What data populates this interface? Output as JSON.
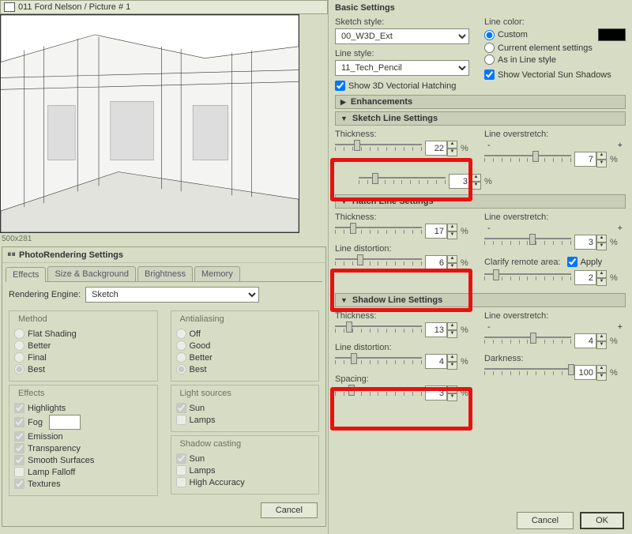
{
  "window_title": "011 Ford Nelson / Picture # 1",
  "preview_dim": "500x281",
  "dlg": {
    "title": "PhotoRendering Settings",
    "tabs": [
      "Effects",
      "Size & Background",
      "Brightness",
      "Memory"
    ],
    "active_tab": 0,
    "engine_label": "Rendering Engine:",
    "engine_value": "Sketch",
    "method": {
      "legend": "Method",
      "opts": [
        "Flat Shading",
        "Better",
        "Final",
        "Best"
      ],
      "sel": 3
    },
    "antialias": {
      "legend": "Antialiasing",
      "opts": [
        "Off",
        "Good",
        "Better",
        "Best"
      ],
      "sel": 3
    },
    "effects": {
      "legend": "Effects",
      "items": [
        {
          "label": "Highlights",
          "on": true
        },
        {
          "label": "Fog",
          "on": true,
          "has_input": true,
          "val": ""
        },
        {
          "label": "Emission",
          "on": true
        },
        {
          "label": "Transparency",
          "on": true
        },
        {
          "label": "Smooth Surfaces",
          "on": true
        },
        {
          "label": "Lamp Falloff",
          "on": false
        },
        {
          "label": "Textures",
          "on": true
        }
      ]
    },
    "light": {
      "legend": "Light sources",
      "items": [
        {
          "label": "Sun",
          "on": true
        },
        {
          "label": "Lamps",
          "on": false
        }
      ]
    },
    "shadow": {
      "legend": "Shadow casting",
      "items": [
        {
          "label": "Sun",
          "on": true
        },
        {
          "label": "Lamps",
          "on": false
        },
        {
          "label": "High Accuracy",
          "on": false
        }
      ]
    },
    "cancel": "Cancel"
  },
  "right": {
    "basic": "Basic Settings",
    "sketch_style_label": "Sketch style:",
    "sketch_style": "00_W3D_Ext",
    "line_style_label": "Line style:",
    "line_style": "11_Tech_Pencil",
    "show_hatch": "Show 3D Vectorial Hatching",
    "line_color_label": "Line color:",
    "lc_opts": [
      "Custom",
      "Current element settings",
      "As in Line style"
    ],
    "lc_sel": 0,
    "show_sun": "Show Vectorial Sun Shadows",
    "enh": "Enhancements",
    "sketch_line": "Sketch Line Settings",
    "hatch_line": "Hatch Line Settings",
    "shadow_line": "Shadow Line Settings",
    "thickness": "Thickness:",
    "overstretch": "Line overstretch:",
    "distortion": "Line distortion:",
    "clarify": "Clarify remote area:",
    "apply": "Apply",
    "darkness": "Darkness:",
    "spacing": "Spacing:",
    "vals": {
      "sl_thick": 22,
      "sl_over": 7,
      "sl_dist": 3,
      "hl_thick": 17,
      "hl_over": 3,
      "hl_dist": 6,
      "hl_clar": 2,
      "sh_thick": 13,
      "sh_over": 4,
      "sh_dist": 4,
      "sh_dark": 100,
      "sh_sp": 3
    },
    "cancel": "Cancel",
    "ok": "OK"
  }
}
